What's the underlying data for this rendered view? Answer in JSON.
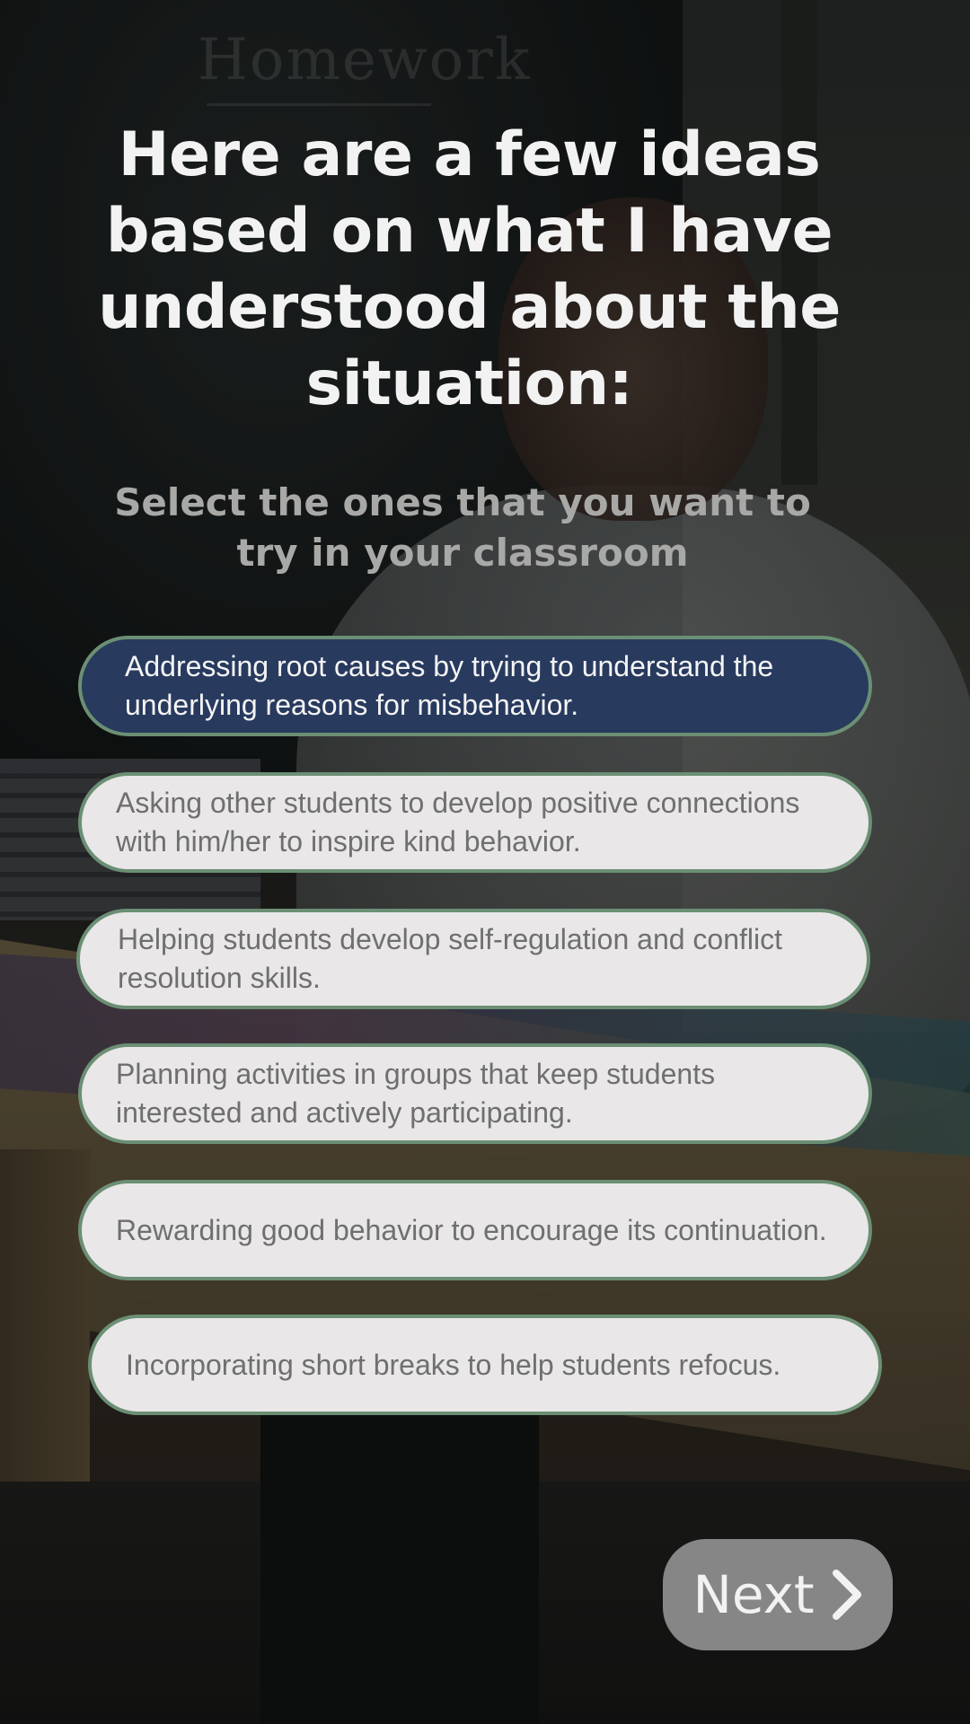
{
  "background": {
    "board_text": "Homework"
  },
  "header": {
    "title": "Here are a few ideas based on what I have understood about the situation:",
    "subtitle": "Select the ones that you want to try in your classroom"
  },
  "options": [
    {
      "label": "Addressing root causes by trying to understand the underlying reasons for misbehavior.",
      "selected": true
    },
    {
      "label": "Asking other students to develop positive connections with him/her to inspire kind behavior.",
      "selected": false
    },
    {
      "label": "Helping students develop self-regulation and conflict resolution skills.",
      "selected": false
    },
    {
      "label": "Planning activities in groups that keep students interested and actively participating.",
      "selected": false
    },
    {
      "label": "Rewarding good behavior to encourage its continuation.",
      "selected": false
    },
    {
      "label": "Incorporating short breaks to help students refocus.",
      "selected": false
    }
  ],
  "footer": {
    "next_label": "Next",
    "next_icon": "chevron-right-icon"
  },
  "colors": {
    "selected_fill": "#283a5e",
    "option_fill": "#e9e7e8",
    "option_border": "#6b8f74",
    "next_button": "#969696"
  }
}
